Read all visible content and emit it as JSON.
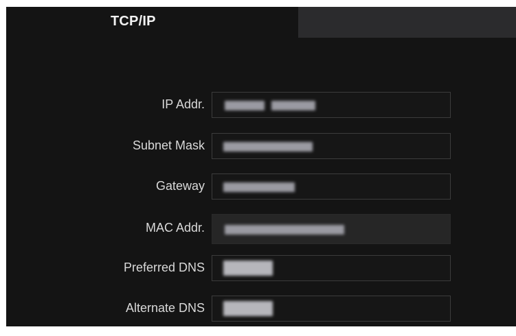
{
  "tabs": {
    "active_label": "TCP/IP",
    "inactive_label": ""
  },
  "fields": [
    {
      "label": "IP Addr.",
      "value": "",
      "value_state": "redacted",
      "editable": true
    },
    {
      "label": "Subnet Mask",
      "value": "",
      "value_state": "redacted",
      "editable": true
    },
    {
      "label": "Gateway",
      "value": "",
      "value_state": "redacted",
      "editable": true
    },
    {
      "label": "MAC Addr.",
      "value": "",
      "value_state": "redacted",
      "editable": false
    },
    {
      "label": "Preferred DNS",
      "value": "",
      "value_state": "redacted",
      "editable": true
    },
    {
      "label": "Alternate DNS",
      "value": "",
      "value_state": "redacted",
      "editable": true
    }
  ],
  "colors": {
    "panel_bg": "#141414",
    "inactive_tab_bg": "#2b2b2d",
    "label_text": "#d9d9d9",
    "field_border": "#3c3c3c"
  }
}
